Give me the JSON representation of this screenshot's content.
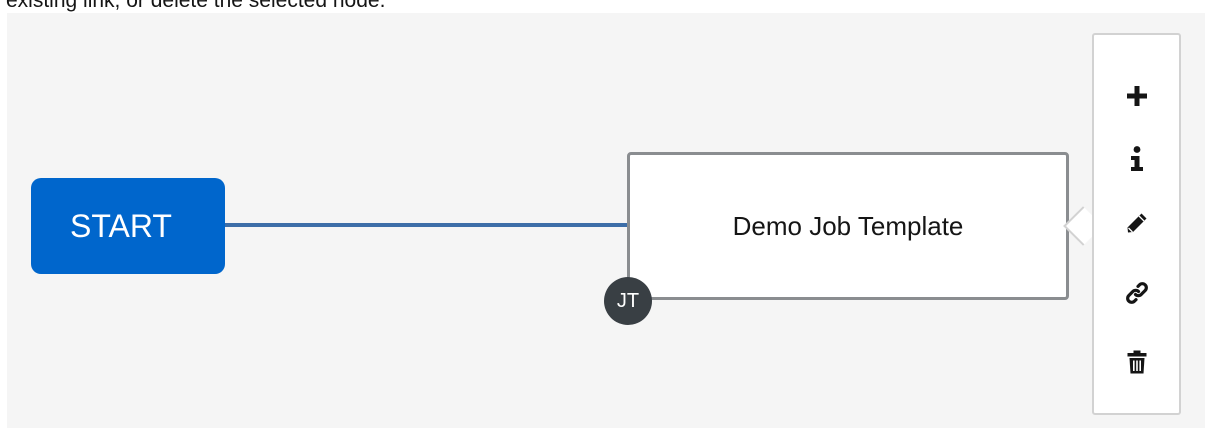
{
  "instructions_text": "existing link, or delete the selected node.",
  "workflow": {
    "start_label": "START",
    "node": {
      "name": "Demo Job Template",
      "type_badge": "JT"
    }
  },
  "toolbar": {
    "tools": [
      {
        "name": "add-node",
        "icon": "plus-icon"
      },
      {
        "name": "node-info",
        "icon": "info-icon"
      },
      {
        "name": "edit-node",
        "icon": "pencil-icon"
      },
      {
        "name": "link-node",
        "icon": "link-icon"
      },
      {
        "name": "delete-node",
        "icon": "trash-icon"
      }
    ]
  },
  "colors": {
    "start_node": "#0066cc",
    "connector": "#3d6ea8",
    "canvas_bg": "#f5f5f5",
    "node_border": "#8a8d90",
    "badge_bg": "#393f44"
  }
}
